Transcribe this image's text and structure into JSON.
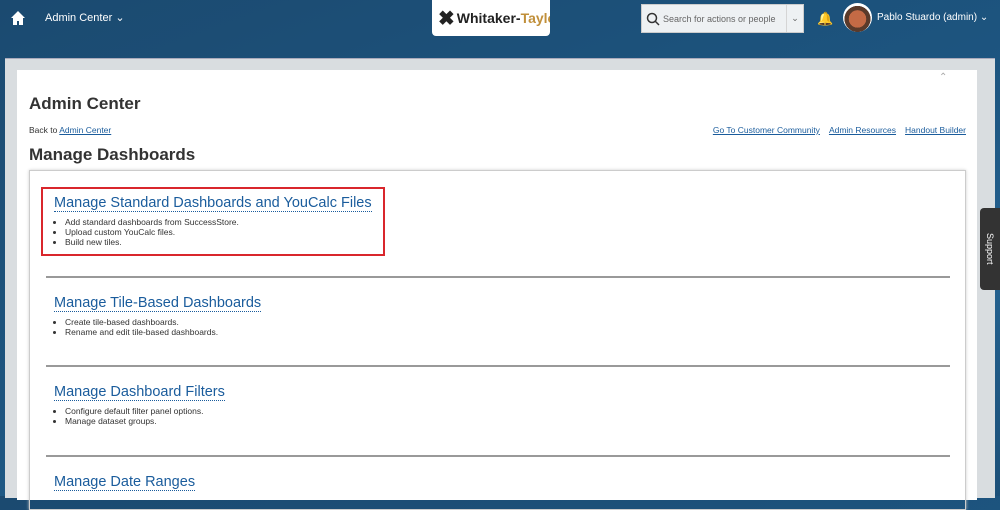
{
  "topbar": {
    "app_menu": "Admin Center",
    "logo_a": "Whitaker-",
    "logo_b": "Taylor",
    "search_placeholder": "Search for actions or people",
    "user": "Pablo Stuardo (admin)"
  },
  "page": {
    "title": "Admin Center",
    "back_prefix": "Back to",
    "back_link": "Admin Center",
    "links": [
      "Go To Customer Community",
      "Admin Resources",
      "Handout Builder"
    ],
    "subtitle": "Manage Dashboards"
  },
  "sections": [
    {
      "title": "Manage Standard Dashboards and YouCalc Files",
      "items": [
        "Add standard dashboards from SuccessStore.",
        "Upload custom YouCalc files.",
        "Build new tiles."
      ]
    },
    {
      "title": "Manage Tile-Based Dashboards",
      "items": [
        "Create tile-based dashboards.",
        "Rename and edit tile-based dashboards."
      ]
    },
    {
      "title": "Manage Dashboard Filters",
      "items": [
        "Configure default filter panel options.",
        "Manage dataset groups."
      ]
    },
    {
      "title": "Manage Date Ranges",
      "items": []
    }
  ],
  "support": "Support"
}
